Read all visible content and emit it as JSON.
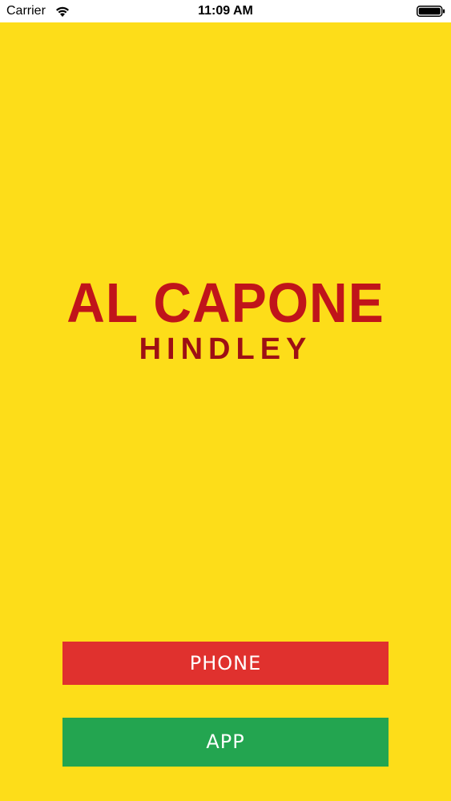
{
  "status_bar": {
    "carrier": "Carrier",
    "time": "11:09 AM",
    "wifi_icon": "wifi-icon",
    "battery_icon": "battery-icon"
  },
  "logo": {
    "title": "AL CAPONE",
    "subtitle": "HINDLEY",
    "color": "#C0141A"
  },
  "actions": {
    "phone_label": "PHONE",
    "app_label": "APP"
  },
  "colors": {
    "background": "#FDDD19",
    "phone_button": "#E0312E",
    "app_button": "#23A550"
  }
}
